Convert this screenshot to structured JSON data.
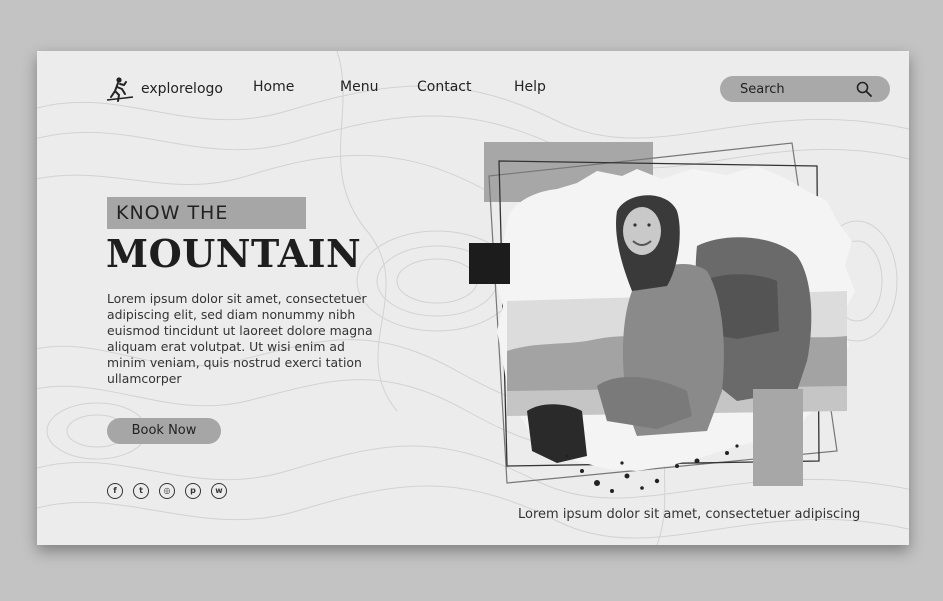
{
  "brand": {
    "logo_text": "explorelogo"
  },
  "nav": {
    "items": [
      "Home",
      "Menu",
      "Contact",
      "Help"
    ]
  },
  "search": {
    "label": "Search"
  },
  "hero": {
    "kicker": "KNOW THE",
    "title": "MOUNTAIN",
    "body": "Lorem ipsum dolor sit amet, consectetuer adipiscing elit, sed diam nonummy nibh euismod tincidunt ut laoreet dolore magna aliquam erat volutpat. Ut wisi enim ad minim veniam, quis nostrud exerci tation ullamcorper",
    "cta": "Book Now",
    "caption": "Lorem ipsum dolor sit amet, consectetuer adipiscing"
  },
  "social": [
    "facebook-icon",
    "twitter-icon",
    "instagram-icon",
    "pinterest-icon",
    "whatsapp-icon"
  ],
  "colors": {
    "page_bg": "#c3c3c3",
    "card_bg": "#ececec",
    "accent_gray": "#a6a6a6",
    "dark": "#1e1e1e"
  }
}
